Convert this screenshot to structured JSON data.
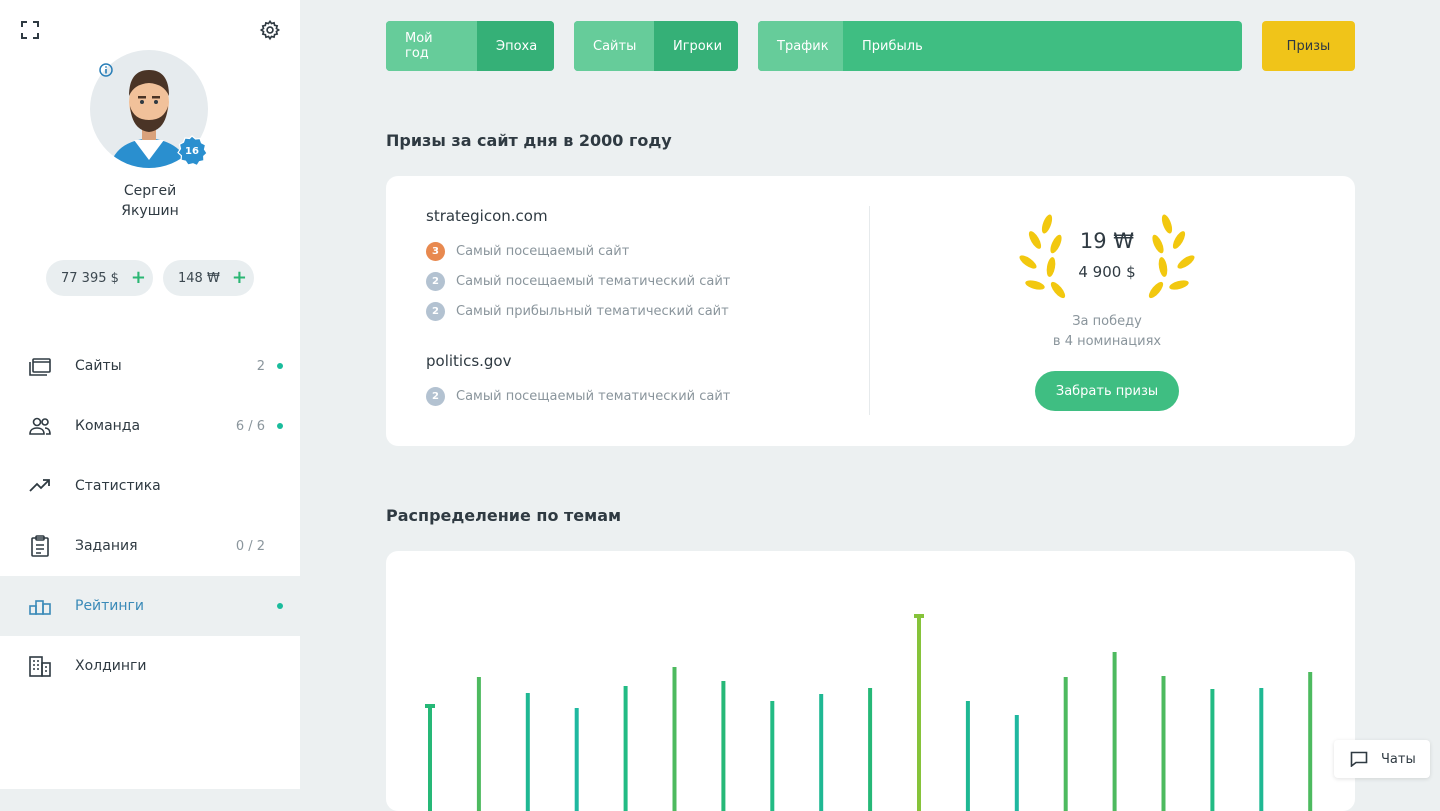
{
  "user": {
    "first_name": "Сергей",
    "last_name": "Якушин",
    "level": "16",
    "balance_usd": "77 395 $",
    "balance_w": "148 ₩",
    "add_label": "+"
  },
  "nav": {
    "items": [
      {
        "label": "Сайты",
        "count": "2",
        "dot": true,
        "icon": "monitor-icon"
      },
      {
        "label": "Команда",
        "count": "6 / 6",
        "dot": true,
        "icon": "team-icon"
      },
      {
        "label": "Статистика",
        "count": "",
        "dot": false,
        "icon": "trend-icon"
      },
      {
        "label": "Задания",
        "count": "0 / 2",
        "dot": false,
        "icon": "clipboard-icon"
      },
      {
        "label": "Рейтинги",
        "count": "",
        "dot": true,
        "icon": "podium-icon",
        "active": true
      },
      {
        "label": "Холдинги",
        "count": "",
        "dot": false,
        "icon": "buildings-icon"
      }
    ]
  },
  "tabs": {
    "group1": [
      "Мой год",
      "Эпоха"
    ],
    "group2": [
      "Сайты",
      "Игроки"
    ],
    "group3": [
      "Трафик",
      "Прибыль"
    ],
    "prizes": "Призы"
  },
  "prizes_section": {
    "title": "Призы за сайт дня в 2000 году",
    "sites": [
      {
        "name": "strategicon.com",
        "nominations": [
          {
            "place": "3",
            "text": "Самый посещаемый сайт"
          },
          {
            "place": "2",
            "text": "Самый посещаемый тематический сайт"
          },
          {
            "place": "2",
            "text": "Самый прибыльный тематический сайт"
          }
        ]
      },
      {
        "name": "politics.gov",
        "nominations": [
          {
            "place": "2",
            "text": "Самый посещаемый тематический сайт"
          }
        ]
      }
    ],
    "reward_w": "19 ₩",
    "reward_usd": "4 900 $",
    "caption_line1": "За победу",
    "caption_line2": "в 4 номинациях",
    "claim_button": "Забрать призы"
  },
  "colors": {
    "place_3": "#e8894f",
    "place_2": "#b3c2d1",
    "accent_green": "#3fbe82",
    "prize_yellow": "#f0c419",
    "laurel": "#f2c80f"
  },
  "distribution_section": {
    "title": "Распределение по темам"
  },
  "chart_data": {
    "type": "bar",
    "title": "",
    "values": [
      76,
      104,
      88,
      73,
      95,
      114,
      100,
      80,
      87,
      93,
      166,
      80,
      66,
      104,
      129,
      105,
      92,
      93,
      109
    ]
  },
  "chat": {
    "label": "Чаты"
  }
}
